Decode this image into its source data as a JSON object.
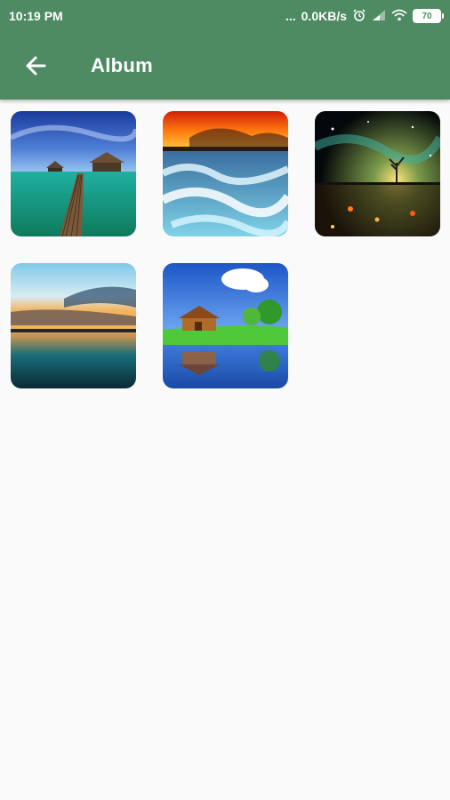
{
  "status": {
    "time": "10:19 PM",
    "dots": "...",
    "net_speed": "0.0KB/s",
    "battery": "70"
  },
  "toolbar": {
    "title": "Album",
    "back_icon": "arrow-back-icon"
  },
  "colors": {
    "appbar": "#4e8a62",
    "background": "#fafafa"
  },
  "album": {
    "images": [
      {
        "name": "tropical-pier"
      },
      {
        "name": "ocean-sunset-waves"
      },
      {
        "name": "galaxy-tree-reflection"
      },
      {
        "name": "lake-sunset"
      },
      {
        "name": "house-lake-reflection"
      }
    ]
  }
}
